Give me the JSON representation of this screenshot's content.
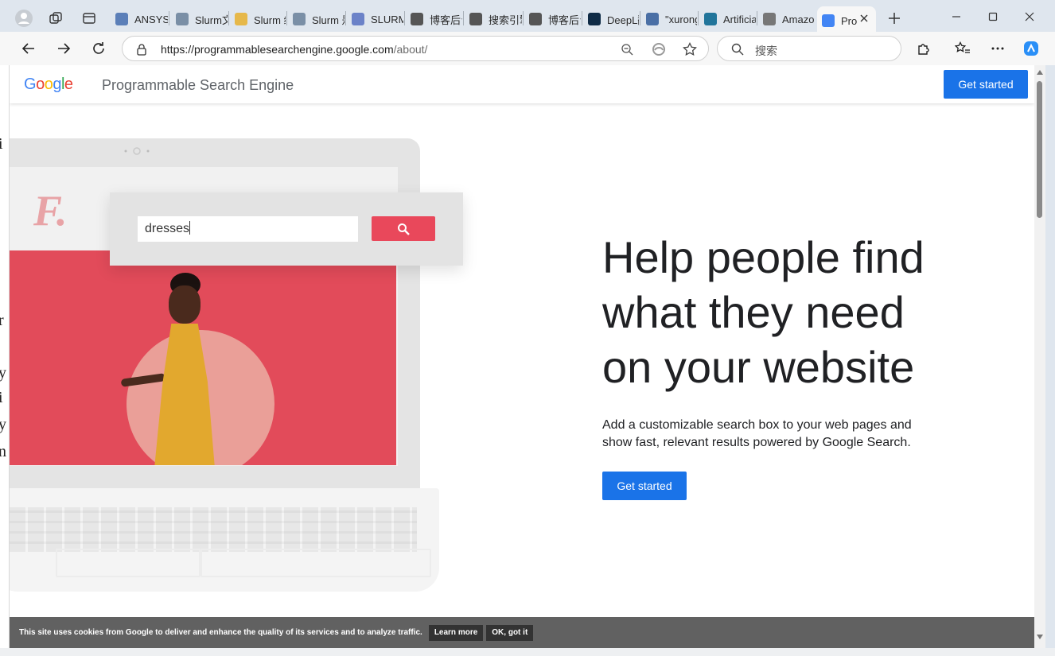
{
  "browser": {
    "tabs": [
      {
        "label": "ANSYS",
        "icon": "robot-icon",
        "color": "#5b7fb8"
      },
      {
        "label": "Slurm文",
        "icon": "slurm-icon",
        "color": "#7a8fa6"
      },
      {
        "label": "Slurm 绪",
        "icon": "folder-icon",
        "color": "#e6b84a"
      },
      {
        "label": "Slurm 是",
        "icon": "slurm-icon",
        "color": "#7a8fa6"
      },
      {
        "label": "SLURM",
        "icon": "circle-logo-icon",
        "color": "#6b82c8"
      },
      {
        "label": "博客后台",
        "icon": "leaf-icon",
        "color": "#555555"
      },
      {
        "label": "搜索引擎",
        "icon": "leaf-icon",
        "color": "#555555"
      },
      {
        "label": "博客后台",
        "icon": "leaf-icon",
        "color": "#555555"
      },
      {
        "label": "DeepL翻",
        "icon": "deepl-icon",
        "color": "#0f2b46"
      },
      {
        "label": "\"xurong",
        "icon": "search-icon",
        "color": "#4a6fa5"
      },
      {
        "label": "Artificia",
        "icon": "wordpress-icon",
        "color": "#21759b"
      },
      {
        "label": "Amazon",
        "icon": "amazon-icon",
        "color": "#777777"
      },
      {
        "label": "Pro",
        "icon": "google-icon",
        "color": "#4285f4",
        "active": true
      }
    ],
    "url_main": "https://programmablesearchengine.google.com",
    "url_path": "/about/",
    "search_placeholder": "搜索"
  },
  "page": {
    "logo": [
      "G",
      "o",
      "o",
      "g",
      "l",
      "e"
    ],
    "logo_colors": [
      "#4285f4",
      "#ea4335",
      "#fbbc05",
      "#4285f4",
      "#34a853",
      "#ea4335"
    ],
    "product_name": "Programmable Search Engine",
    "header_cta": "Get started",
    "demo_query": "dresses",
    "demo_brand": "F.",
    "headline_lines": [
      "Help people find",
      "what they need",
      "on your website"
    ],
    "subtext_lines": [
      "Add a customizable search box to your web pages and",
      "show fast, relevant results powered by Google Search."
    ],
    "body_cta": "Get started",
    "accent": "#1a73e8"
  },
  "cookie": {
    "text": "This site uses cookies from Google to deliver and enhance the quality of its services and to analyze traffic.",
    "learn_more": "Learn more",
    "ok": "OK, got it"
  },
  "left_edge_glyphs": [
    "i",
    "r",
    "y",
    "i",
    "y",
    "n"
  ]
}
